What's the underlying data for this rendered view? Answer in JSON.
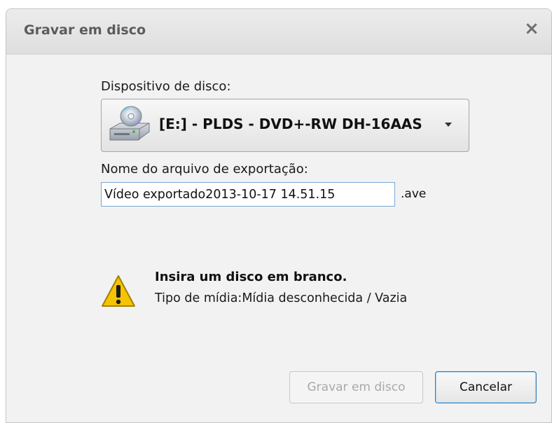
{
  "window": {
    "title": "Gravar em disco",
    "close_glyph": "×",
    "close_icon": "close-icon"
  },
  "device": {
    "label": "Dispositivo de disco:",
    "selected": "[E:] - PLDS - DVD+-RW DH-16AAS",
    "icon": "optical-drive-icon"
  },
  "export_name": {
    "label": "Nome do arquivo de exportação:",
    "value": "Vídeo exportado2013-10-17 14.51.15",
    "extension": ".ave"
  },
  "warning": {
    "icon": "warning-icon",
    "title": "Insira um disco em branco.",
    "detail": "Tipo de mídia:Mídia desconhecida / Vazia"
  },
  "buttons": {
    "burn": "Gravar em disco",
    "cancel": "Cancelar"
  },
  "colors": {
    "warning_yellow": "#f5c400",
    "focus_border": "#3c7fb1",
    "disabled_text": "#a9a9a9"
  }
}
